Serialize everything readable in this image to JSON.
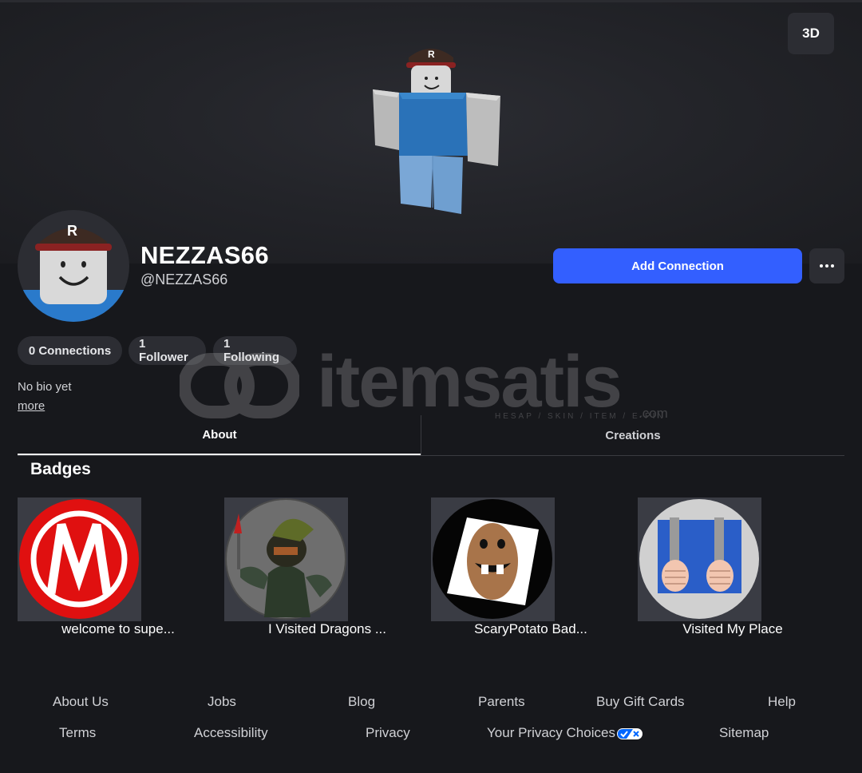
{
  "header": {
    "view_toggle_label": "3D"
  },
  "profile": {
    "display_name": "NEZZAS66",
    "username": "@NEZZAS66",
    "add_connection_label": "Add Connection",
    "stats": {
      "connections": "0 Connections",
      "followers": "1 Follower",
      "following": "1 Following"
    },
    "bio": "No bio yet",
    "more_link": "more"
  },
  "watermark": {
    "brand": "itemsatis",
    "tagline": "HESAP / SKIN / ITEM / E-PIN",
    "suffix": ".com"
  },
  "tabs": [
    {
      "label": "About",
      "active": true
    },
    {
      "label": "Creations",
      "active": false
    }
  ],
  "badges": {
    "title": "Badges",
    "items": [
      {
        "label": "welcome to supe...",
        "icon": "m-logo-badge-icon"
      },
      {
        "label": "I Visited Dragons ...",
        "icon": "dragon-warrior-badge-icon"
      },
      {
        "label": "ScaryPotato Bad...",
        "icon": "scary-potato-badge-icon"
      },
      {
        "label": "Visited My Place",
        "icon": "jail-bars-badge-icon"
      }
    ]
  },
  "footer": {
    "row1": [
      "About Us",
      "Jobs",
      "Blog",
      "Parents",
      "Buy Gift Cards",
      "Help"
    ],
    "row2": [
      "Terms",
      "Accessibility",
      "Privacy",
      "Your Privacy Choices",
      "Sitemap"
    ]
  },
  "colors": {
    "background": "#17181c",
    "primary_button": "#335fff",
    "surface": "#2c2d33"
  }
}
